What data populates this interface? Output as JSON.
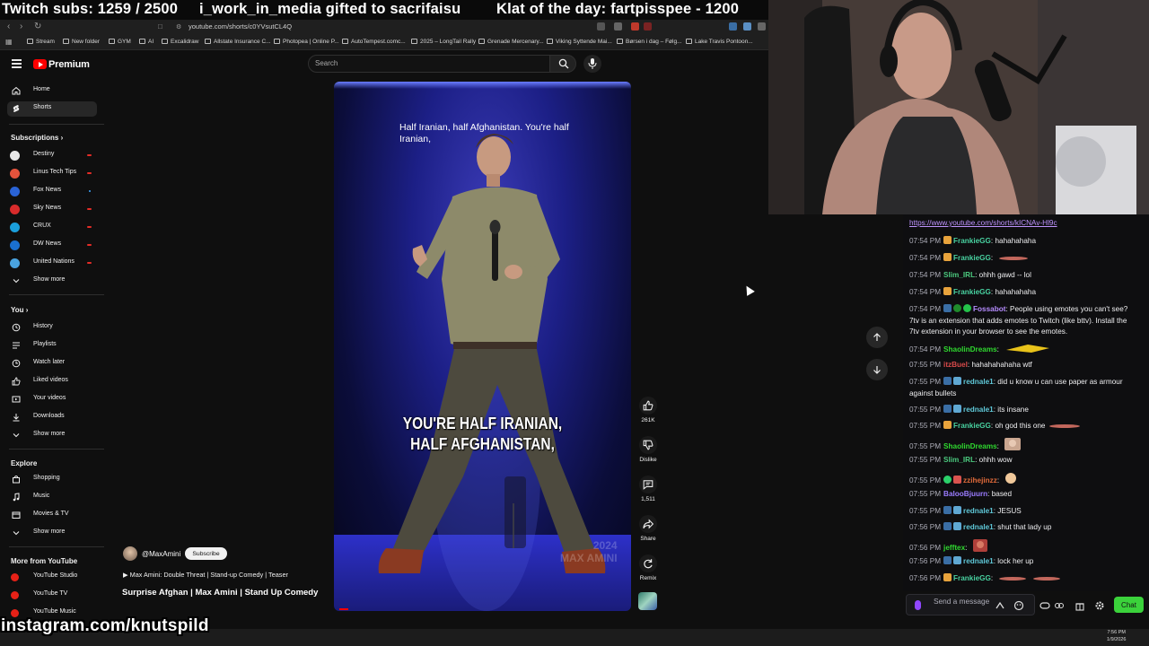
{
  "overlay": {
    "subs": "Twitch subs: 1259 / 2500",
    "gift": "i_work_in_media gifted to sacrifaisu",
    "klat": "Klat of the day: fartpisspee - 1200",
    "instagram": "instagram.com/knutspild"
  },
  "browser": {
    "url": "youtube.com/shorts/c0YVsutCL4Q",
    "bookmarks": [
      "Stream",
      "New folder",
      "GYM",
      "AI",
      "Excalidraw",
      "Allstate Insurance C...",
      "Photopea | Online P...",
      "AutoTempest.comc...",
      "2025 – LongTail Rally",
      "Grenade Mercenary...",
      "Viking Syttende Mai...",
      "Børsen i dag – Følg...",
      "Lake Travis Pontoon..."
    ]
  },
  "youtube": {
    "brand": "Premium",
    "search_placeholder": "Search",
    "nav": [
      {
        "label": "Home",
        "icon": "home-icon"
      },
      {
        "label": "Shorts",
        "icon": "shorts-icon",
        "active": true
      }
    ],
    "subscriptions_title": "Subscriptions",
    "subscriptions": [
      {
        "label": "Destiny",
        "color": "#e7e7e7",
        "live": true
      },
      {
        "label": "Linus Tech Tips",
        "color": "#e5533c",
        "live": true
      },
      {
        "label": "Fox News",
        "color": "#2a63d6",
        "live": false,
        "dot": true
      },
      {
        "label": "Sky News",
        "color": "#d92b2b",
        "live": true
      },
      {
        "label": "CRUX",
        "color": "#1b9fdc",
        "live": true
      },
      {
        "label": "DW News",
        "color": "#1a6fd0",
        "live": true
      },
      {
        "label": "United Nations",
        "color": "#4aa3df",
        "live": true
      }
    ],
    "show_more": "Show more",
    "you_title": "You",
    "you_items": [
      {
        "label": "History",
        "icon": "history-icon"
      },
      {
        "label": "Playlists",
        "icon": "playlists-icon"
      },
      {
        "label": "Watch later",
        "icon": "watch-later-icon"
      },
      {
        "label": "Liked videos",
        "icon": "liked-videos-icon"
      },
      {
        "label": "Your videos",
        "icon": "your-videos-icon"
      },
      {
        "label": "Downloads",
        "icon": "downloads-icon"
      }
    ],
    "explore_title": "Explore",
    "explore_items": [
      {
        "label": "Shopping",
        "icon": "shopping-icon"
      },
      {
        "label": "Music",
        "icon": "music-icon"
      },
      {
        "label": "Movies & TV",
        "icon": "movies-icon"
      }
    ],
    "more_title": "More from YouTube",
    "more_items": [
      {
        "label": "YouTube Studio"
      },
      {
        "label": "YouTube TV"
      },
      {
        "label": "YouTube Music"
      }
    ],
    "video": {
      "caption_top": "Half Iranian, half Afghanistan. You're half Iranian,",
      "caption_line1": "YOU'RE HALF IRANIAN,",
      "caption_line2": "HALF AFGHANISTAN,",
      "watermark_year": "2024",
      "watermark_name": "MAX AMINI",
      "channel": "@MaxAmini",
      "subscribe": "Subscribe",
      "teaser": "Max Amini: Double Threat | Stand-up Comedy | Teaser",
      "title": "Surprise Afghan | Max Amini | Stand Up Comedy"
    },
    "actions": {
      "likes": "261K",
      "dislike": "Dislike",
      "comments": "1,511",
      "share": "Share",
      "remix": "Remix"
    }
  },
  "chat": {
    "link": "https://www.youtube.com/shorts/kICNAv-Hl9c",
    "messages": [
      {
        "ts": "07:54 PM",
        "user": "FrankieGG",
        "color": "#48d1a0",
        "text": "hahahahaha"
      },
      {
        "ts": "07:54 PM",
        "user": "FrankieGG",
        "color": "#48d1a0",
        "text": ""
      },
      {
        "ts": "07:54 PM",
        "user": "Slim_IRL",
        "color": "#4bc97e",
        "text": "ohhh gawd -- lol"
      },
      {
        "ts": "07:54 PM",
        "user": "FrankieGG",
        "color": "#48d1a0",
        "text": "hahahahaha"
      },
      {
        "ts": "07:54 PM",
        "user": "Fossabot",
        "color": "#b68cff",
        "text": "People using emotes you can't see? 7tv is an extension that adds emotes to Twitch (like bttv). Install the 7tv extension in your browser to see the emotes."
      },
      {
        "ts": "07:54 PM",
        "user": "ShaolinDreams",
        "color": "#2fd92f",
        "text": ""
      },
      {
        "ts": "07:55 PM",
        "user": "itzBuel",
        "color": "#d94a4a",
        "text": "hahahahahaha wtf"
      },
      {
        "ts": "07:55 PM",
        "user": "rednale1",
        "color": "#5fc8d8",
        "text": "did u know u can use paper as armour against bullets"
      },
      {
        "ts": "07:55 PM",
        "user": "rednale1",
        "color": "#5fc8d8",
        "text": "its insane"
      },
      {
        "ts": "07:55 PM",
        "user": "FrankieGG",
        "color": "#48d1a0",
        "text": "oh god this one"
      },
      {
        "ts": "07:55 PM",
        "user": "ShaolinDreams",
        "color": "#2fd92f",
        "text": ""
      },
      {
        "ts": "07:55 PM",
        "user": "Slim_IRL",
        "color": "#4bc97e",
        "text": "ohhh wow"
      },
      {
        "ts": "07:55 PM",
        "user": "zzihejinzz",
        "color": "#e06a3a",
        "text": ""
      },
      {
        "ts": "07:55 PM",
        "user": "BalooBjuurn",
        "color": "#9b7cff",
        "text": "based"
      },
      {
        "ts": "07:55 PM",
        "user": "rednale1",
        "color": "#5fc8d8",
        "text": "JESUS"
      },
      {
        "ts": "07:56 PM",
        "user": "rednale1",
        "color": "#5fc8d8",
        "text": "shut that lady up"
      },
      {
        "ts": "07:56 PM",
        "user": "jefftex",
        "color": "#2fd92f",
        "text": ""
      },
      {
        "ts": "07:56 PM",
        "user": "rednale1",
        "color": "#5fc8d8",
        "text": "lock her up"
      },
      {
        "ts": "07:56 PM",
        "user": "FrankieGG",
        "color": "#48d1a0",
        "text": ""
      }
    ],
    "input_placeholder": "Send a message",
    "chat_button": "Chat"
  },
  "system": {
    "time": "7:56 PM",
    "date": "1/9/2026"
  }
}
